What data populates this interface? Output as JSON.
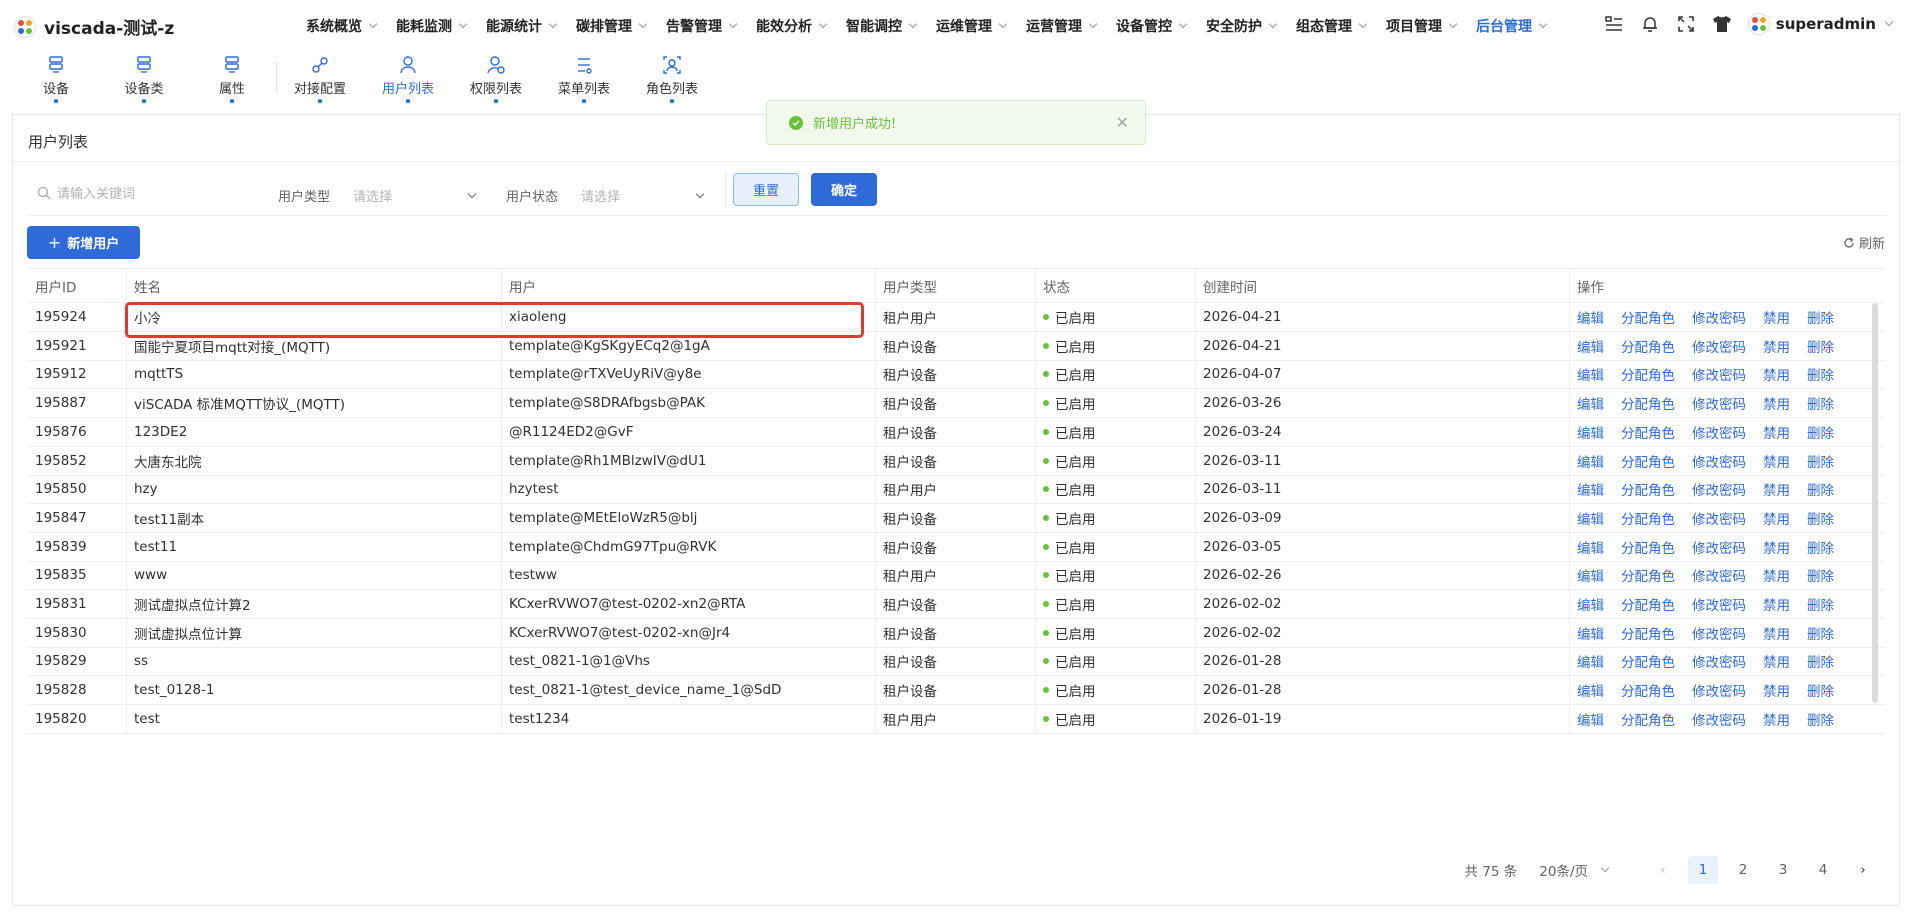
{
  "app": {
    "title": "viscada-测试-z",
    "user": "superadmin"
  },
  "nav": [
    {
      "label": "系统概览"
    },
    {
      "label": "能耗监测"
    },
    {
      "label": "能源统计"
    },
    {
      "label": "碳排管理"
    },
    {
      "label": "告警管理"
    },
    {
      "label": "能效分析"
    },
    {
      "label": "智能调控"
    },
    {
      "label": "运维管理"
    },
    {
      "label": "运营管理"
    },
    {
      "label": "设备管控"
    },
    {
      "label": "安全防护"
    },
    {
      "label": "组态管理"
    },
    {
      "label": "项目管理"
    },
    {
      "label": "后台管理",
      "active": true
    }
  ],
  "subnav": [
    {
      "label": "设备",
      "icon": "device-icon"
    },
    {
      "label": "设备类",
      "icon": "device-class-icon"
    },
    {
      "label": "属性",
      "icon": "attribute-icon"
    },
    {
      "label": "对接配置",
      "icon": "integration-icon"
    },
    {
      "label": "用户列表",
      "icon": "user-list-icon",
      "active": true
    },
    {
      "label": "权限列表",
      "icon": "permission-icon"
    },
    {
      "label": "菜单列表",
      "icon": "menu-list-icon"
    },
    {
      "label": "角色列表",
      "icon": "role-list-icon"
    }
  ],
  "toast": {
    "message": "新增用户成功!"
  },
  "panel": {
    "title": "用户列表"
  },
  "filter": {
    "search_placeholder": "请输入关键词",
    "user_type_label": "用户类型",
    "user_type_placeholder": "请选择",
    "user_status_label": "用户状态",
    "user_status_placeholder": "请选择",
    "reset_label": "重置",
    "confirm_label": "确定"
  },
  "actions": {
    "add_label": "新增用户",
    "refresh_label": "刷新"
  },
  "table": {
    "headers": {
      "id": "用户ID",
      "name": "姓名",
      "user": "用户",
      "type": "用户类型",
      "status": "状态",
      "created": "创建时间",
      "ops": "操作"
    },
    "op_labels": [
      "编辑",
      "分配角色",
      "修改密码",
      "禁用",
      "删除"
    ],
    "rows": [
      {
        "id": "195924",
        "name": "小冷",
        "user": "xiaoleng",
        "type": "租户用户",
        "status": "已启用",
        "created": "2026-04-21"
      },
      {
        "id": "195921",
        "name": "国能宁夏项目mqtt对接_(MQTT)",
        "user": "template@KgSKgyECq2@1gA",
        "type": "租户设备",
        "status": "已启用",
        "created": "2026-04-21"
      },
      {
        "id": "195912",
        "name": "mqttTS",
        "user": "template@rTXVeUyRiV@y8e",
        "type": "租户设备",
        "status": "已启用",
        "created": "2026-04-07"
      },
      {
        "id": "195887",
        "name": "viSCADA 标准MQTT协议_(MQTT)",
        "user": "template@S8DRAfbgsb@PAK",
        "type": "租户设备",
        "status": "已启用",
        "created": "2026-03-26"
      },
      {
        "id": "195876",
        "name": "123DE2",
        "user": "@R1124ED2@GvF",
        "type": "租户设备",
        "status": "已启用",
        "created": "2026-03-24"
      },
      {
        "id": "195852",
        "name": "大唐东北院",
        "user": "template@Rh1MBlzwIV@dU1",
        "type": "租户设备",
        "status": "已启用",
        "created": "2026-03-11"
      },
      {
        "id": "195850",
        "name": "hzy",
        "user": "hzytest",
        "type": "租户用户",
        "status": "已启用",
        "created": "2026-03-11"
      },
      {
        "id": "195847",
        "name": "test11副本",
        "user": "template@MEtEloWzR5@blj",
        "type": "租户设备",
        "status": "已启用",
        "created": "2026-03-09"
      },
      {
        "id": "195839",
        "name": "test11",
        "user": "template@ChdmG97Tpu@RVK",
        "type": "租户设备",
        "status": "已启用",
        "created": "2026-03-05"
      },
      {
        "id": "195835",
        "name": "www",
        "user": "testww",
        "type": "租户用户",
        "status": "已启用",
        "created": "2026-02-26"
      },
      {
        "id": "195831",
        "name": "测试虚拟点位计算2",
        "user": "KCxerRVWO7@test-0202-xn2@RTA",
        "type": "租户设备",
        "status": "已启用",
        "created": "2026-02-02"
      },
      {
        "id": "195830",
        "name": "测试虚拟点位计算",
        "user": "KCxerRVWO7@test-0202-xn@Jr4",
        "type": "租户设备",
        "status": "已启用",
        "created": "2026-02-02"
      },
      {
        "id": "195829",
        "name": "ss",
        "user": "test_0821-1@1@Vhs",
        "type": "租户设备",
        "status": "已启用",
        "created": "2026-01-28"
      },
      {
        "id": "195828",
        "name": "test_0128-1",
        "user": "test_0821-1@test_device_name_1@SdD",
        "type": "租户设备",
        "status": "已启用",
        "created": "2026-01-28"
      },
      {
        "id": "195820",
        "name": "test",
        "user": "test1234",
        "type": "租户用户",
        "status": "已启用",
        "created": "2026-01-19"
      }
    ]
  },
  "pagination": {
    "total": "共 75 条",
    "page_size": "20条/页",
    "pages": [
      "1",
      "2",
      "3",
      "4"
    ],
    "current": "1"
  },
  "colors": {
    "accent": "#2f6bd8",
    "success": "#67c23a",
    "highlight": "#e03a2a"
  }
}
